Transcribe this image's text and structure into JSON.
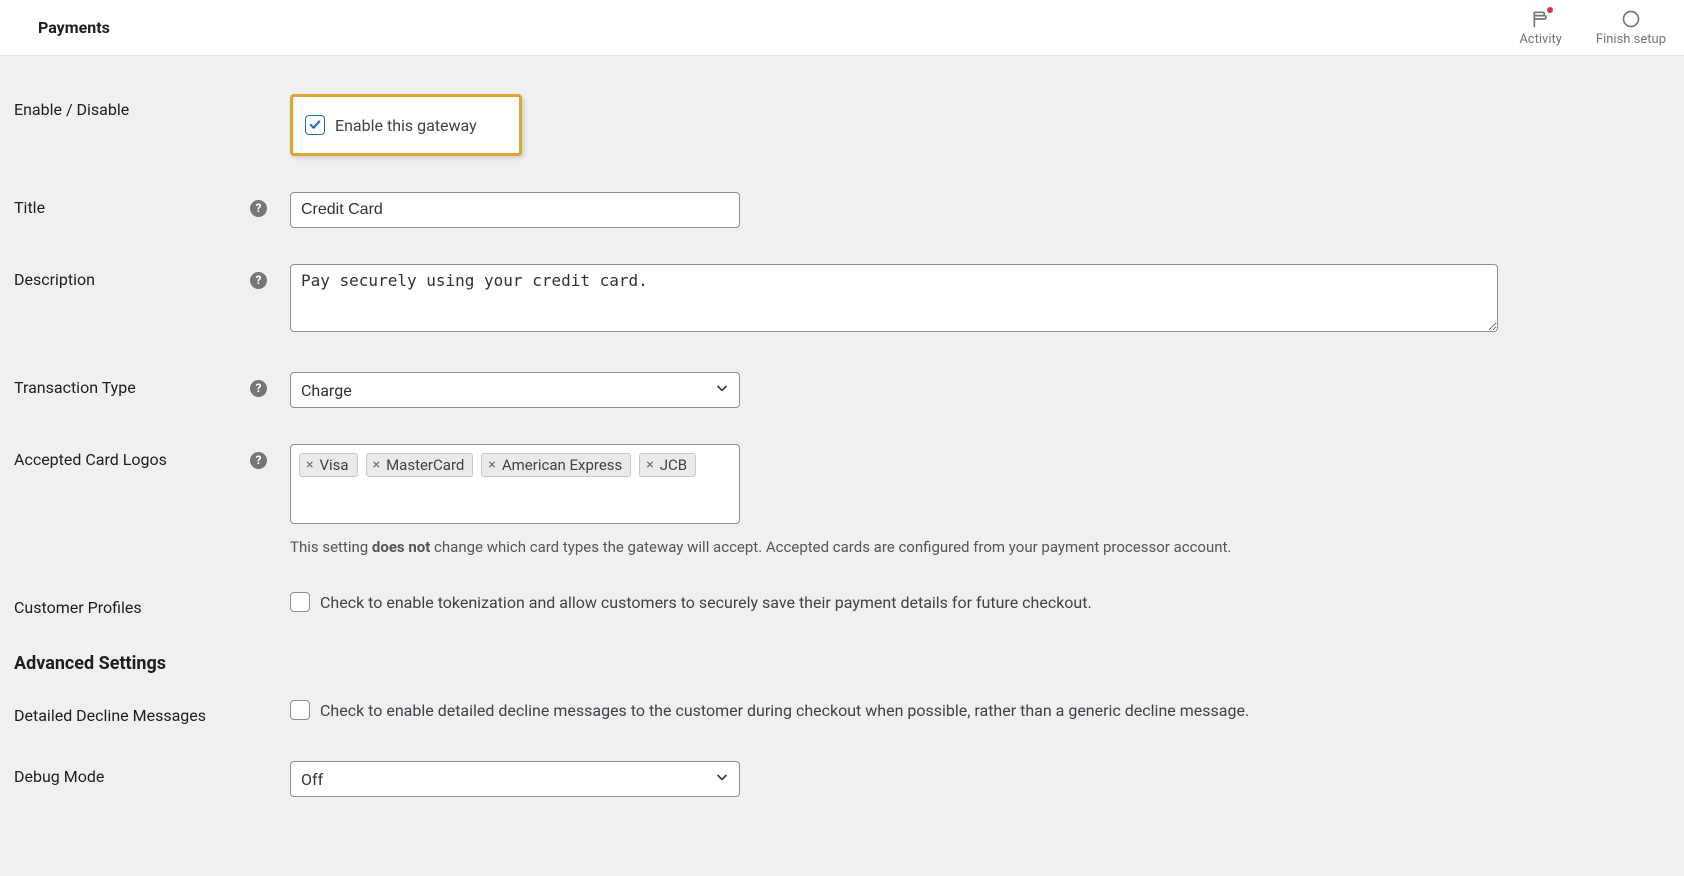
{
  "topbar": {
    "title": "Payments",
    "activity_label": "Activity",
    "finish_label": "Finish setup"
  },
  "fields": {
    "enable": {
      "label": "Enable / Disable",
      "checkbox_label": "Enable this gateway",
      "checked": true
    },
    "title": {
      "label": "Title",
      "value": "Credit Card"
    },
    "description": {
      "label": "Description",
      "value": "Pay securely using your credit card."
    },
    "transaction_type": {
      "label": "Transaction Type",
      "value": "Charge"
    },
    "accepted_logos": {
      "label": "Accepted Card Logos",
      "tags": [
        "Visa",
        "MasterCard",
        "American Express",
        "JCB"
      ],
      "note_prefix": "This setting ",
      "note_bold": "does not",
      "note_suffix": " change which card types the gateway will accept. Accepted cards are configured from your payment processor account."
    },
    "customer_profiles": {
      "label": "Customer Profiles",
      "checkbox_label": "Check to enable tokenization and allow customers to securely save their payment details for future checkout.",
      "checked": false
    },
    "advanced_heading": "Advanced Settings",
    "detailed_decline": {
      "label": "Detailed Decline Messages",
      "checkbox_label": "Check to enable detailed decline messages to the customer during checkout when possible, rather than a generic decline message.",
      "checked": false
    },
    "debug_mode": {
      "label": "Debug Mode",
      "value": "Off"
    }
  }
}
